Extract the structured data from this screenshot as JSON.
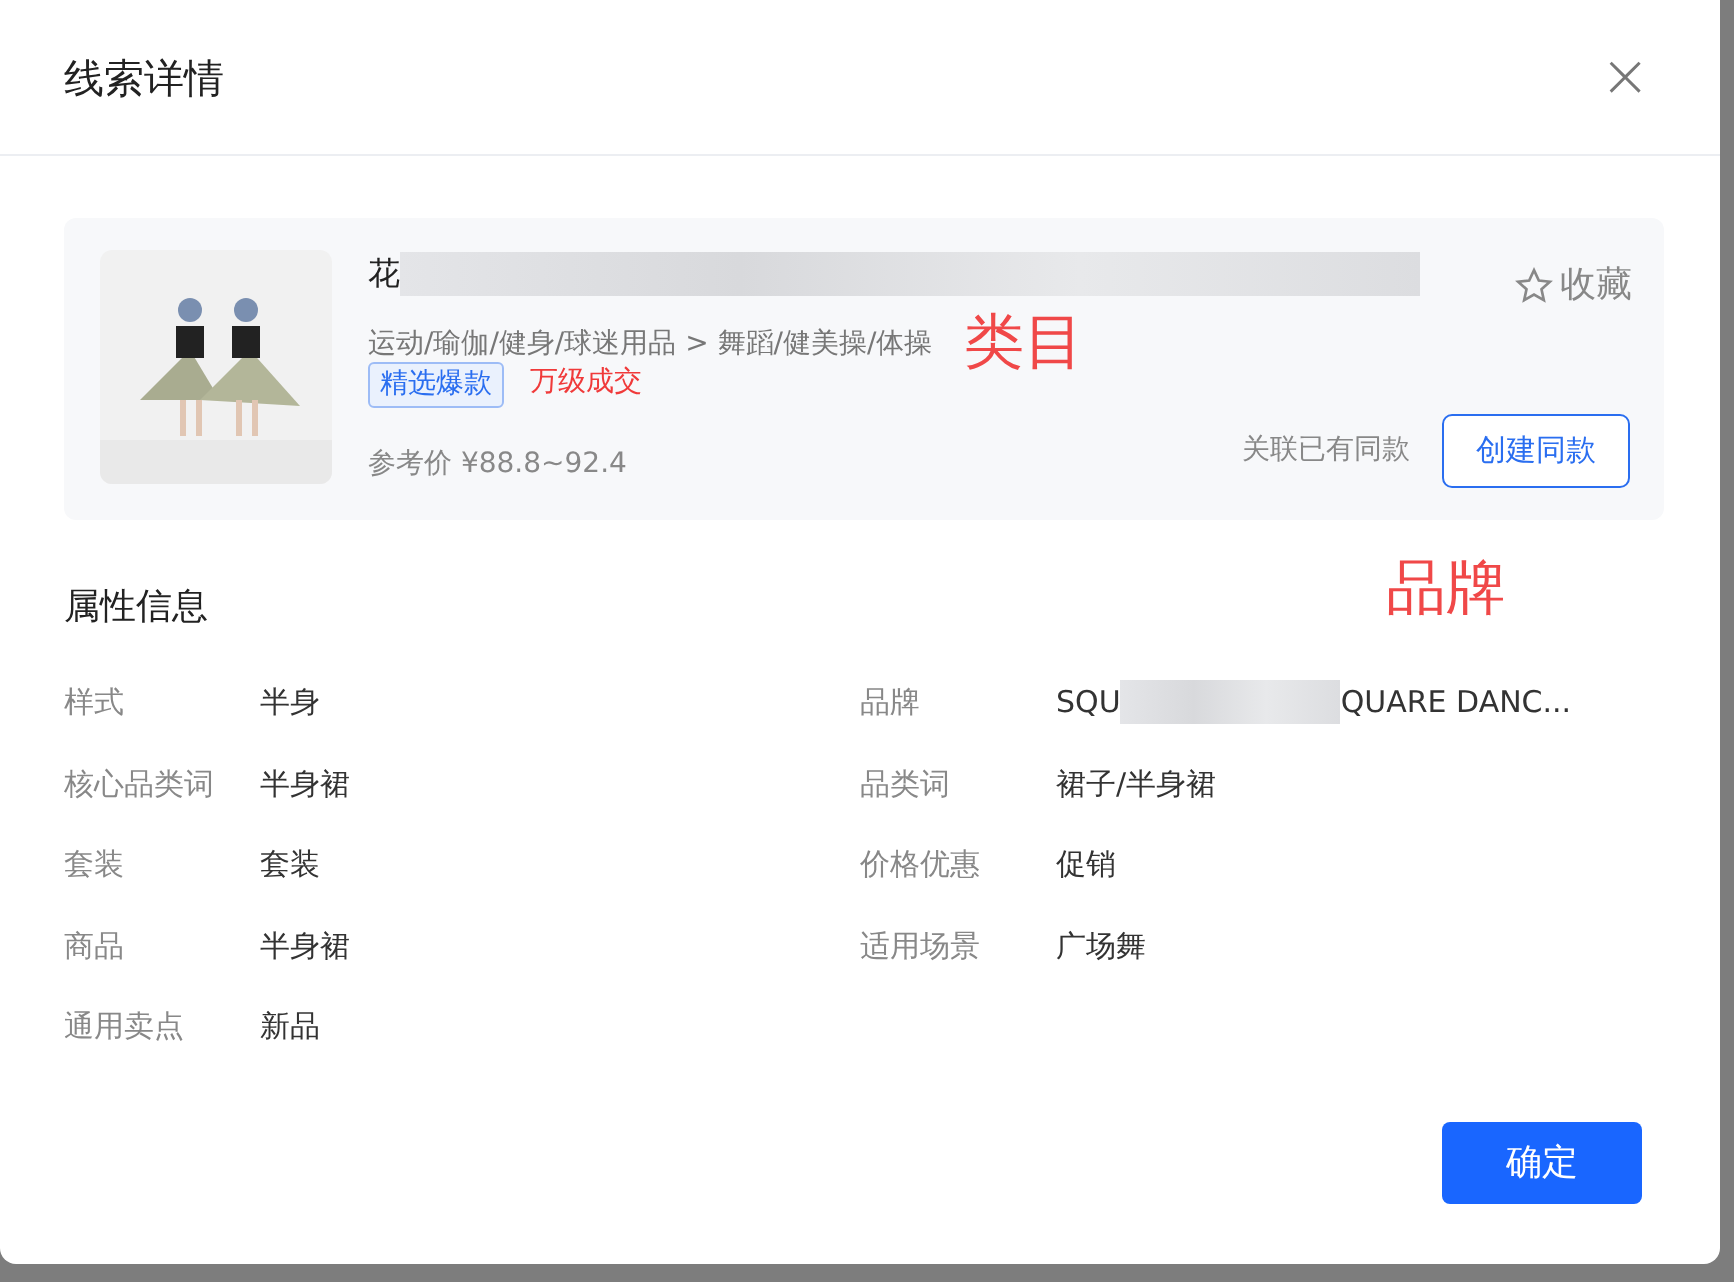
{
  "dialog": {
    "title": "线索详情",
    "close_label": "×"
  },
  "product": {
    "kind": "picture",
    "title_start": "花",
    "title_redacted": true,
    "category": "运动/瑜伽/健身/球迷用品 > 舞蹈/健美操/体操",
    "tags": [
      {
        "label": "精选爆款",
        "kind": "outline"
      },
      {
        "label": "万级成交",
        "kind": "plain"
      }
    ],
    "category_annotation": "类目",
    "price_label": "参考价",
    "price": "¥88.8~92.4",
    "favorite": {
      "label": "收藏",
      "selected": false
    },
    "link_text": "关联已有同款",
    "create_button": "创建同款"
  },
  "attributes": {
    "heading": "属性信息",
    "annotation": "品牌",
    "columns": [
      [
        {
          "label": "样式",
          "value": "半身"
        },
        {
          "label": "核心品类词",
          "value": "半身裙"
        },
        {
          "label": "套装",
          "value": "套装"
        },
        {
          "label": "商品",
          "value": "半身裙"
        },
        {
          "label": "通用卖点",
          "value": "新品"
        }
      ],
      [
        {
          "label": "品牌",
          "value": "SQU",
          "value_after": "QUARE DANC...",
          "redacted": true
        },
        {
          "label": "品类词",
          "value": "裙子/半身裙"
        },
        {
          "label": "价格优惠",
          "value": "促销"
        },
        {
          "label": "适用场景",
          "value": "广场舞"
        }
      ]
    ]
  },
  "ok_button": "确定"
}
